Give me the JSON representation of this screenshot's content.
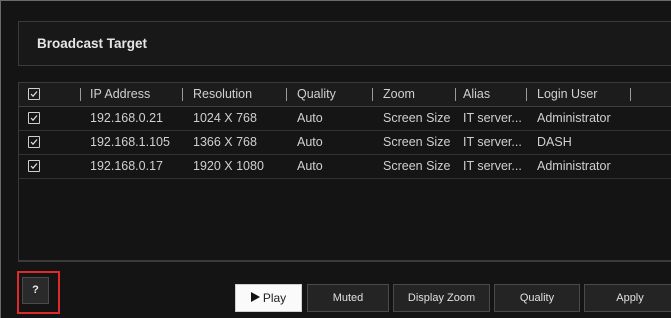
{
  "panel": {
    "title": "Broadcast Target"
  },
  "table": {
    "columns": [
      "IP Address",
      "Resolution",
      "Quality",
      "Zoom",
      "Alias",
      "Login User"
    ],
    "rows": [
      {
        "checked": true,
        "ip": "192.168.0.21",
        "resolution": "1024 X 768",
        "quality": "Auto",
        "zoom": "Screen Size",
        "alias": "IT server...",
        "login_user": "Administrator"
      },
      {
        "checked": true,
        "ip": "192.168.1.105",
        "resolution": "1366 X 768",
        "quality": "Auto",
        "zoom": "Screen Size",
        "alias": "IT server...",
        "login_user": "DASH"
      },
      {
        "checked": true,
        "ip": "192.168.0.17",
        "resolution": "1920 X 1080",
        "quality": "Auto",
        "zoom": "Screen Size",
        "alias": "IT server...",
        "login_user": "Administrator"
      }
    ]
  },
  "toolbar": {
    "help_label": "?",
    "play_label": "Play",
    "muted_label": "Muted",
    "display_zoom_label": "Display Zoom",
    "quality_label": "Quality",
    "apply_label": "Apply"
  },
  "colors": {
    "background": "#141414",
    "highlight": "#e02a2a",
    "play_button": "#fafafa"
  },
  "icons": {
    "checkbox": "checkbox-checked-icon",
    "play": "play-triangle-icon"
  }
}
